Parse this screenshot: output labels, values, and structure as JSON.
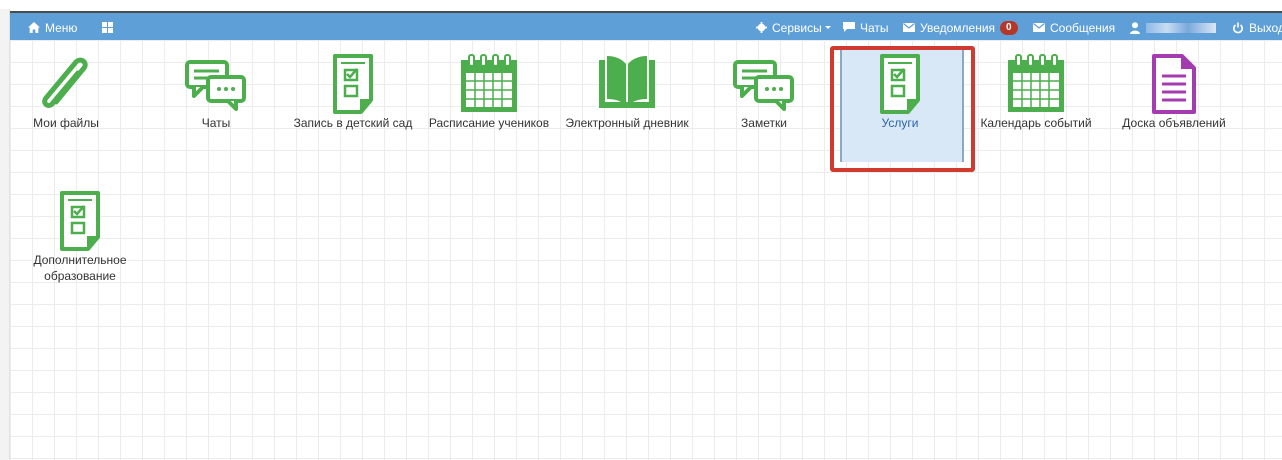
{
  "topbar": {
    "menu_label": "Меню",
    "services_label": "Сервисы",
    "chats_label": "Чаты",
    "notifications_label": "Уведомления",
    "notifications_count": "0",
    "messages_label": "Сообщения",
    "logout_label": "Выход"
  },
  "tiles": [
    {
      "label": "Мои файлы",
      "icon": "paperclip-icon"
    },
    {
      "label": "Чаты",
      "icon": "chat-bubbles-icon"
    },
    {
      "label": "Запись в детский сад",
      "icon": "checklist-document-icon"
    },
    {
      "label": "Расписание учеников",
      "icon": "calendar-icon"
    },
    {
      "label": "Электронный дневник",
      "icon": "open-book-icon"
    },
    {
      "label": "Заметки",
      "icon": "chat-bubbles-icon"
    },
    {
      "label": "Услуги",
      "icon": "checklist-document-icon",
      "selected": true
    },
    {
      "label": "Календарь событий",
      "icon": "calendar-icon"
    },
    {
      "label": "Доска объявлений",
      "icon": "document-lines-icon"
    },
    {
      "label": "Дополнительное образование",
      "icon": "checklist-document-icon"
    }
  ],
  "colors": {
    "topbar": "#5e9fd8",
    "icon_green": "#4cae4c",
    "icon_purple": "#a43bb0",
    "selection": "#d9e8f7",
    "callout_red": "#d23a2f",
    "badge": "#b5372a"
  }
}
